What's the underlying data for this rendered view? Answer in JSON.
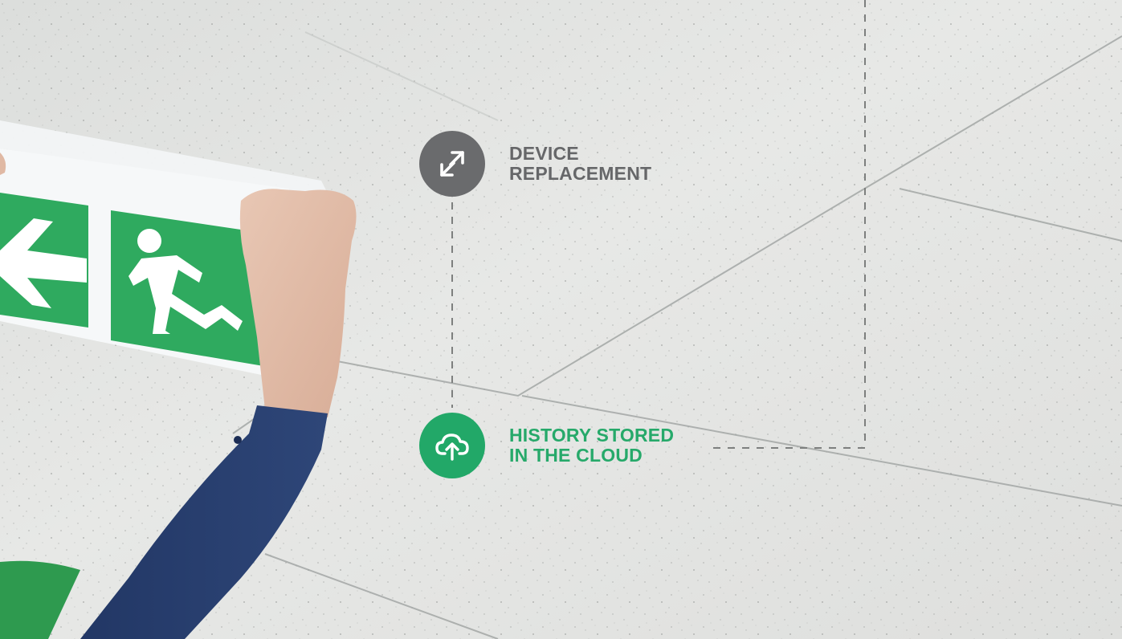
{
  "steps": [
    {
      "label": "DEVICE REPLACEMENT",
      "icon": "swap-arrows-icon",
      "color": "#666769"
    },
    {
      "label": "HISTORY STORED IN THE CLOUD",
      "icon": "cloud-upload-icon",
      "color": "#22a868"
    }
  ],
  "sign": {
    "icons": [
      "arrow-left-icon",
      "running-man-icon"
    ],
    "color": "#2faa5f"
  }
}
